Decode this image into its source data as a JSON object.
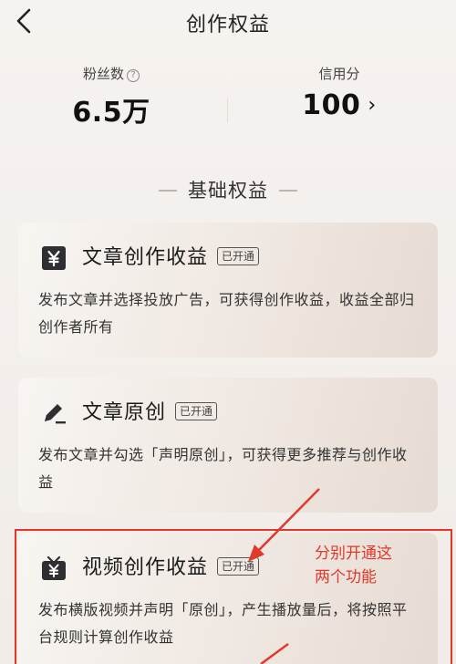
{
  "header": {
    "title": "创作权益"
  },
  "stats": {
    "fans_label": "粉丝数",
    "fans_value": "6.5万",
    "credit_label": "信用分",
    "credit_value": "100"
  },
  "section": {
    "title": "基础权益"
  },
  "cards": [
    {
      "title": "文章创作收益",
      "badge": "已开通",
      "desc": "发布文章并选择投放广告，可获得创作收益，收益全部归创作者所有"
    },
    {
      "title": "文章原创",
      "badge": "已开通",
      "desc": "发布文章并勾选「声明原创」，可获得更多推荐与创作收益"
    },
    {
      "title": "视频创作收益",
      "badge": "已开通",
      "desc": "发布横版视频并声明「原创」，产生播放量后，将按照平台规则计算创作收益"
    }
  ],
  "annotation": {
    "line1": "分别开通这",
    "line2": "两个功能"
  },
  "colors": {
    "annotation": "#e0392b",
    "background": "#f3efec"
  },
  "icons": [
    "back-arrow-icon",
    "help-circle-icon",
    "chevron-right-icon",
    "yen-icon",
    "pen-icon",
    "tv-yen-icon"
  ]
}
